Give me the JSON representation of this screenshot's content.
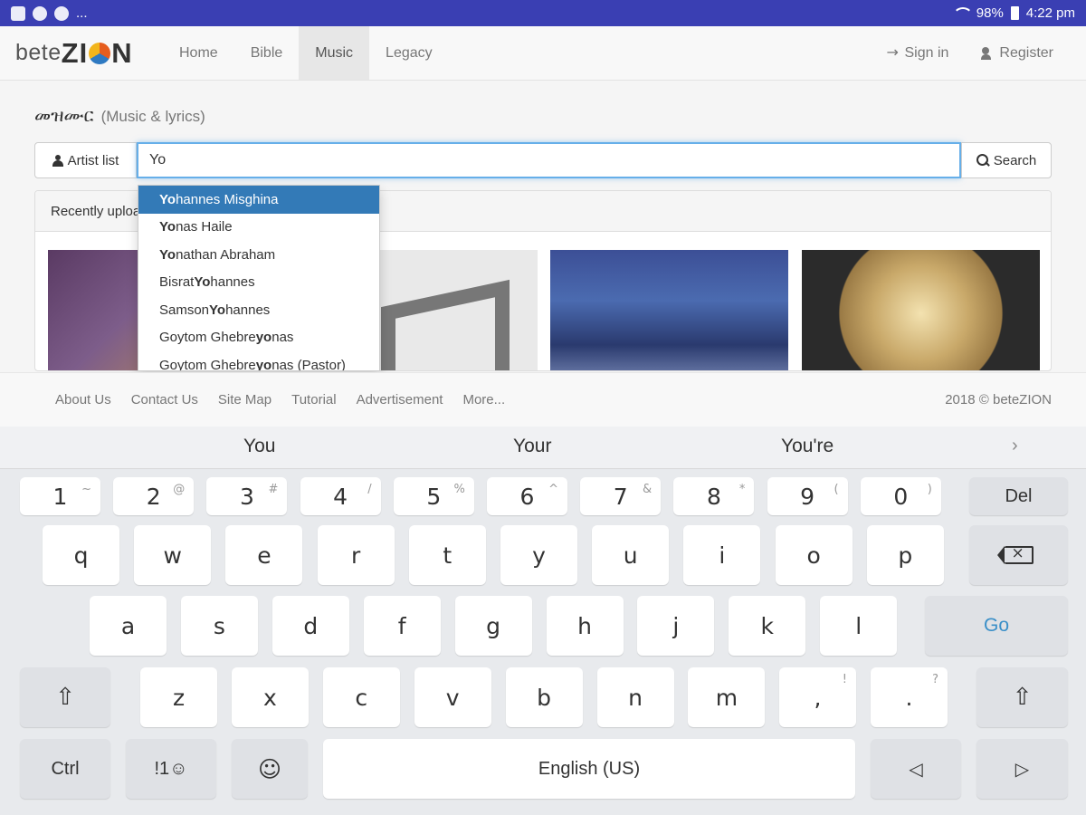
{
  "status_bar": {
    "left_dots": "...",
    "battery": "98%",
    "time": "4:22 pm"
  },
  "navbar": {
    "logo_light": "bete",
    "logo_bold_left": "ZI",
    "logo_bold_right": "N",
    "links": [
      {
        "label": "Home",
        "active": false
      },
      {
        "label": "Bible",
        "active": false
      },
      {
        "label": "Music",
        "active": true
      },
      {
        "label": "Legacy",
        "active": false
      }
    ],
    "sign_in": "Sign in",
    "register": "Register"
  },
  "page": {
    "title": "መዝሙር",
    "subtitle": "(Music & lyrics)"
  },
  "search": {
    "artist_list_label": "Artist list",
    "value": "Yo",
    "button_label": "Search"
  },
  "panel": {
    "heading": "Recently uploaded"
  },
  "autocomplete": [
    {
      "pre": "",
      "match": "Yo",
      "post": "hannes Misghina",
      "active": true
    },
    {
      "pre": "",
      "match": "Yo",
      "post": "nas Haile",
      "active": false
    },
    {
      "pre": "",
      "match": "Yo",
      "post": "nathan Abraham",
      "active": false
    },
    {
      "pre": "Bisrat ",
      "match": "Yo",
      "post": "hannes",
      "active": false
    },
    {
      "pre": "Samson ",
      "match": "Yo",
      "post": "hannes",
      "active": false
    },
    {
      "pre": "Goytom Ghebre",
      "match": "yo",
      "post": "nas",
      "active": false
    },
    {
      "pre": "Goytom Ghebre",
      "match": "yo",
      "post": "nas (Pastor)",
      "active": false
    }
  ],
  "footer": {
    "links": [
      "About Us",
      "Contact Us",
      "Site Map",
      "Tutorial",
      "Advertisement",
      "More..."
    ],
    "copyright": "2018 © beteZION"
  },
  "keyboard": {
    "suggestions": [
      "You",
      "Your",
      "You're"
    ],
    "number_row": [
      {
        "main": "1",
        "alt": "~"
      },
      {
        "main": "2",
        "alt": "@"
      },
      {
        "main": "3",
        "alt": "#"
      },
      {
        "main": "4",
        "alt": "/"
      },
      {
        "main": "5",
        "alt": "%"
      },
      {
        "main": "6",
        "alt": "^"
      },
      {
        "main": "7",
        "alt": "&"
      },
      {
        "main": "8",
        "alt": "*"
      },
      {
        "main": "9",
        "alt": "("
      },
      {
        "main": "0",
        "alt": ")"
      }
    ],
    "del_label": "Del",
    "row_q": [
      "q",
      "w",
      "e",
      "r",
      "t",
      "y",
      "u",
      "i",
      "o",
      "p"
    ],
    "row_a": [
      "a",
      "s",
      "d",
      "f",
      "g",
      "h",
      "j",
      "k",
      "l"
    ],
    "go_label": "Go",
    "row_z": [
      "z",
      "x",
      "c",
      "v",
      "b",
      "n",
      "m"
    ],
    "comma_alt": "!",
    "period_alt": "?",
    "ctrl_label": "Ctrl",
    "symbols_label": "!1☺",
    "space_label": "English (US)"
  }
}
